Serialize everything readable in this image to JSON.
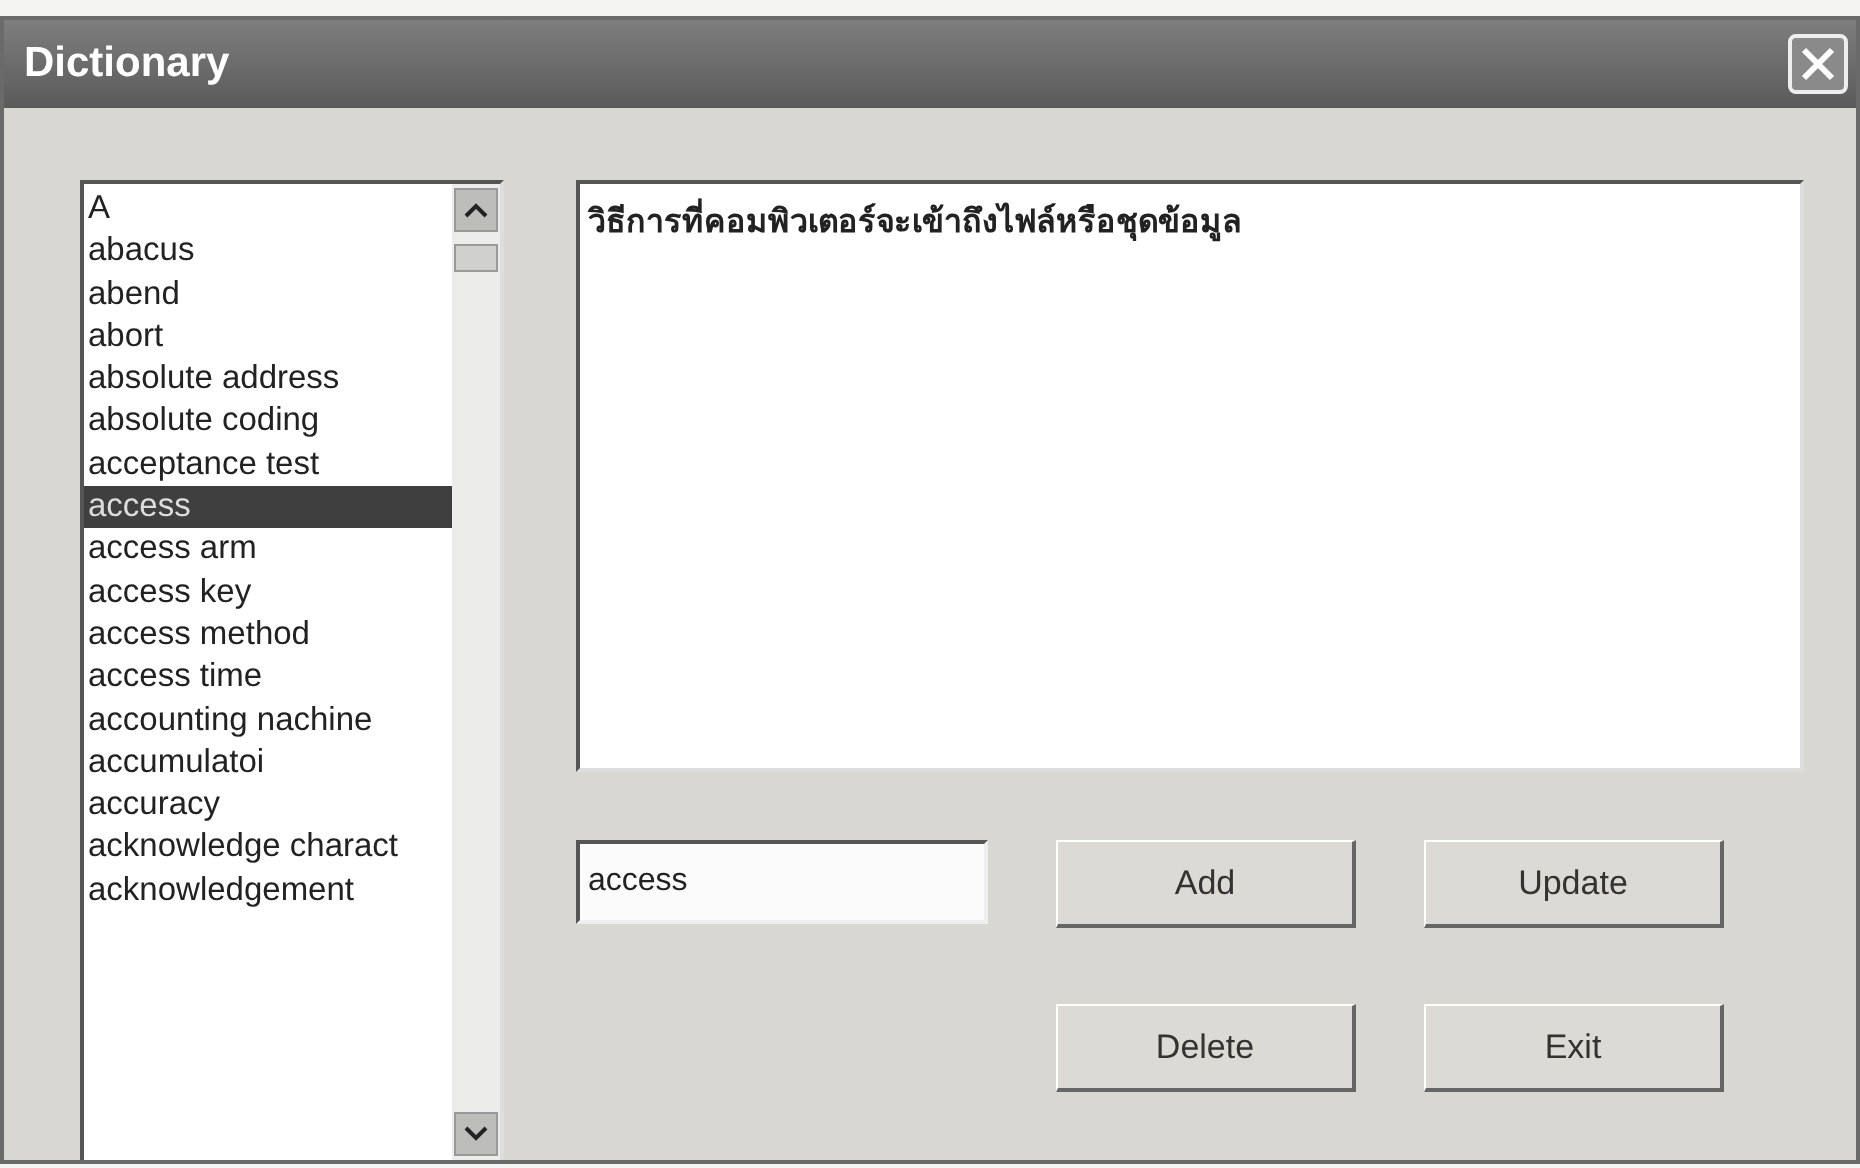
{
  "window": {
    "title": "Dictionary"
  },
  "word_list": {
    "items": [
      {
        "label": "A",
        "selected": false
      },
      {
        "label": "abacus",
        "selected": false
      },
      {
        "label": "abend",
        "selected": false
      },
      {
        "label": "abort",
        "selected": false
      },
      {
        "label": "absolute address",
        "selected": false
      },
      {
        "label": "absolute coding",
        "selected": false
      },
      {
        "label": "acceptance test",
        "selected": false
      },
      {
        "label": "access",
        "selected": true
      },
      {
        "label": "access arm",
        "selected": false
      },
      {
        "label": "access key",
        "selected": false
      },
      {
        "label": "access method",
        "selected": false
      },
      {
        "label": "access time",
        "selected": false
      },
      {
        "label": "accounting nachine",
        "selected": false
      },
      {
        "label": "accumulatoi",
        "selected": false
      },
      {
        "label": "accuracy",
        "selected": false
      },
      {
        "label": "acknowledge charact",
        "selected": false
      },
      {
        "label": "acknowledgement",
        "selected": false
      }
    ]
  },
  "definition": "วิธีการที่คอมพิวเตอร์จะเข้าถึงไฟล์หรือชุดข้อมูล",
  "word_field": {
    "value": "access"
  },
  "buttons": [
    "Add",
    "Update",
    "Delete",
    "Exit"
  ]
}
